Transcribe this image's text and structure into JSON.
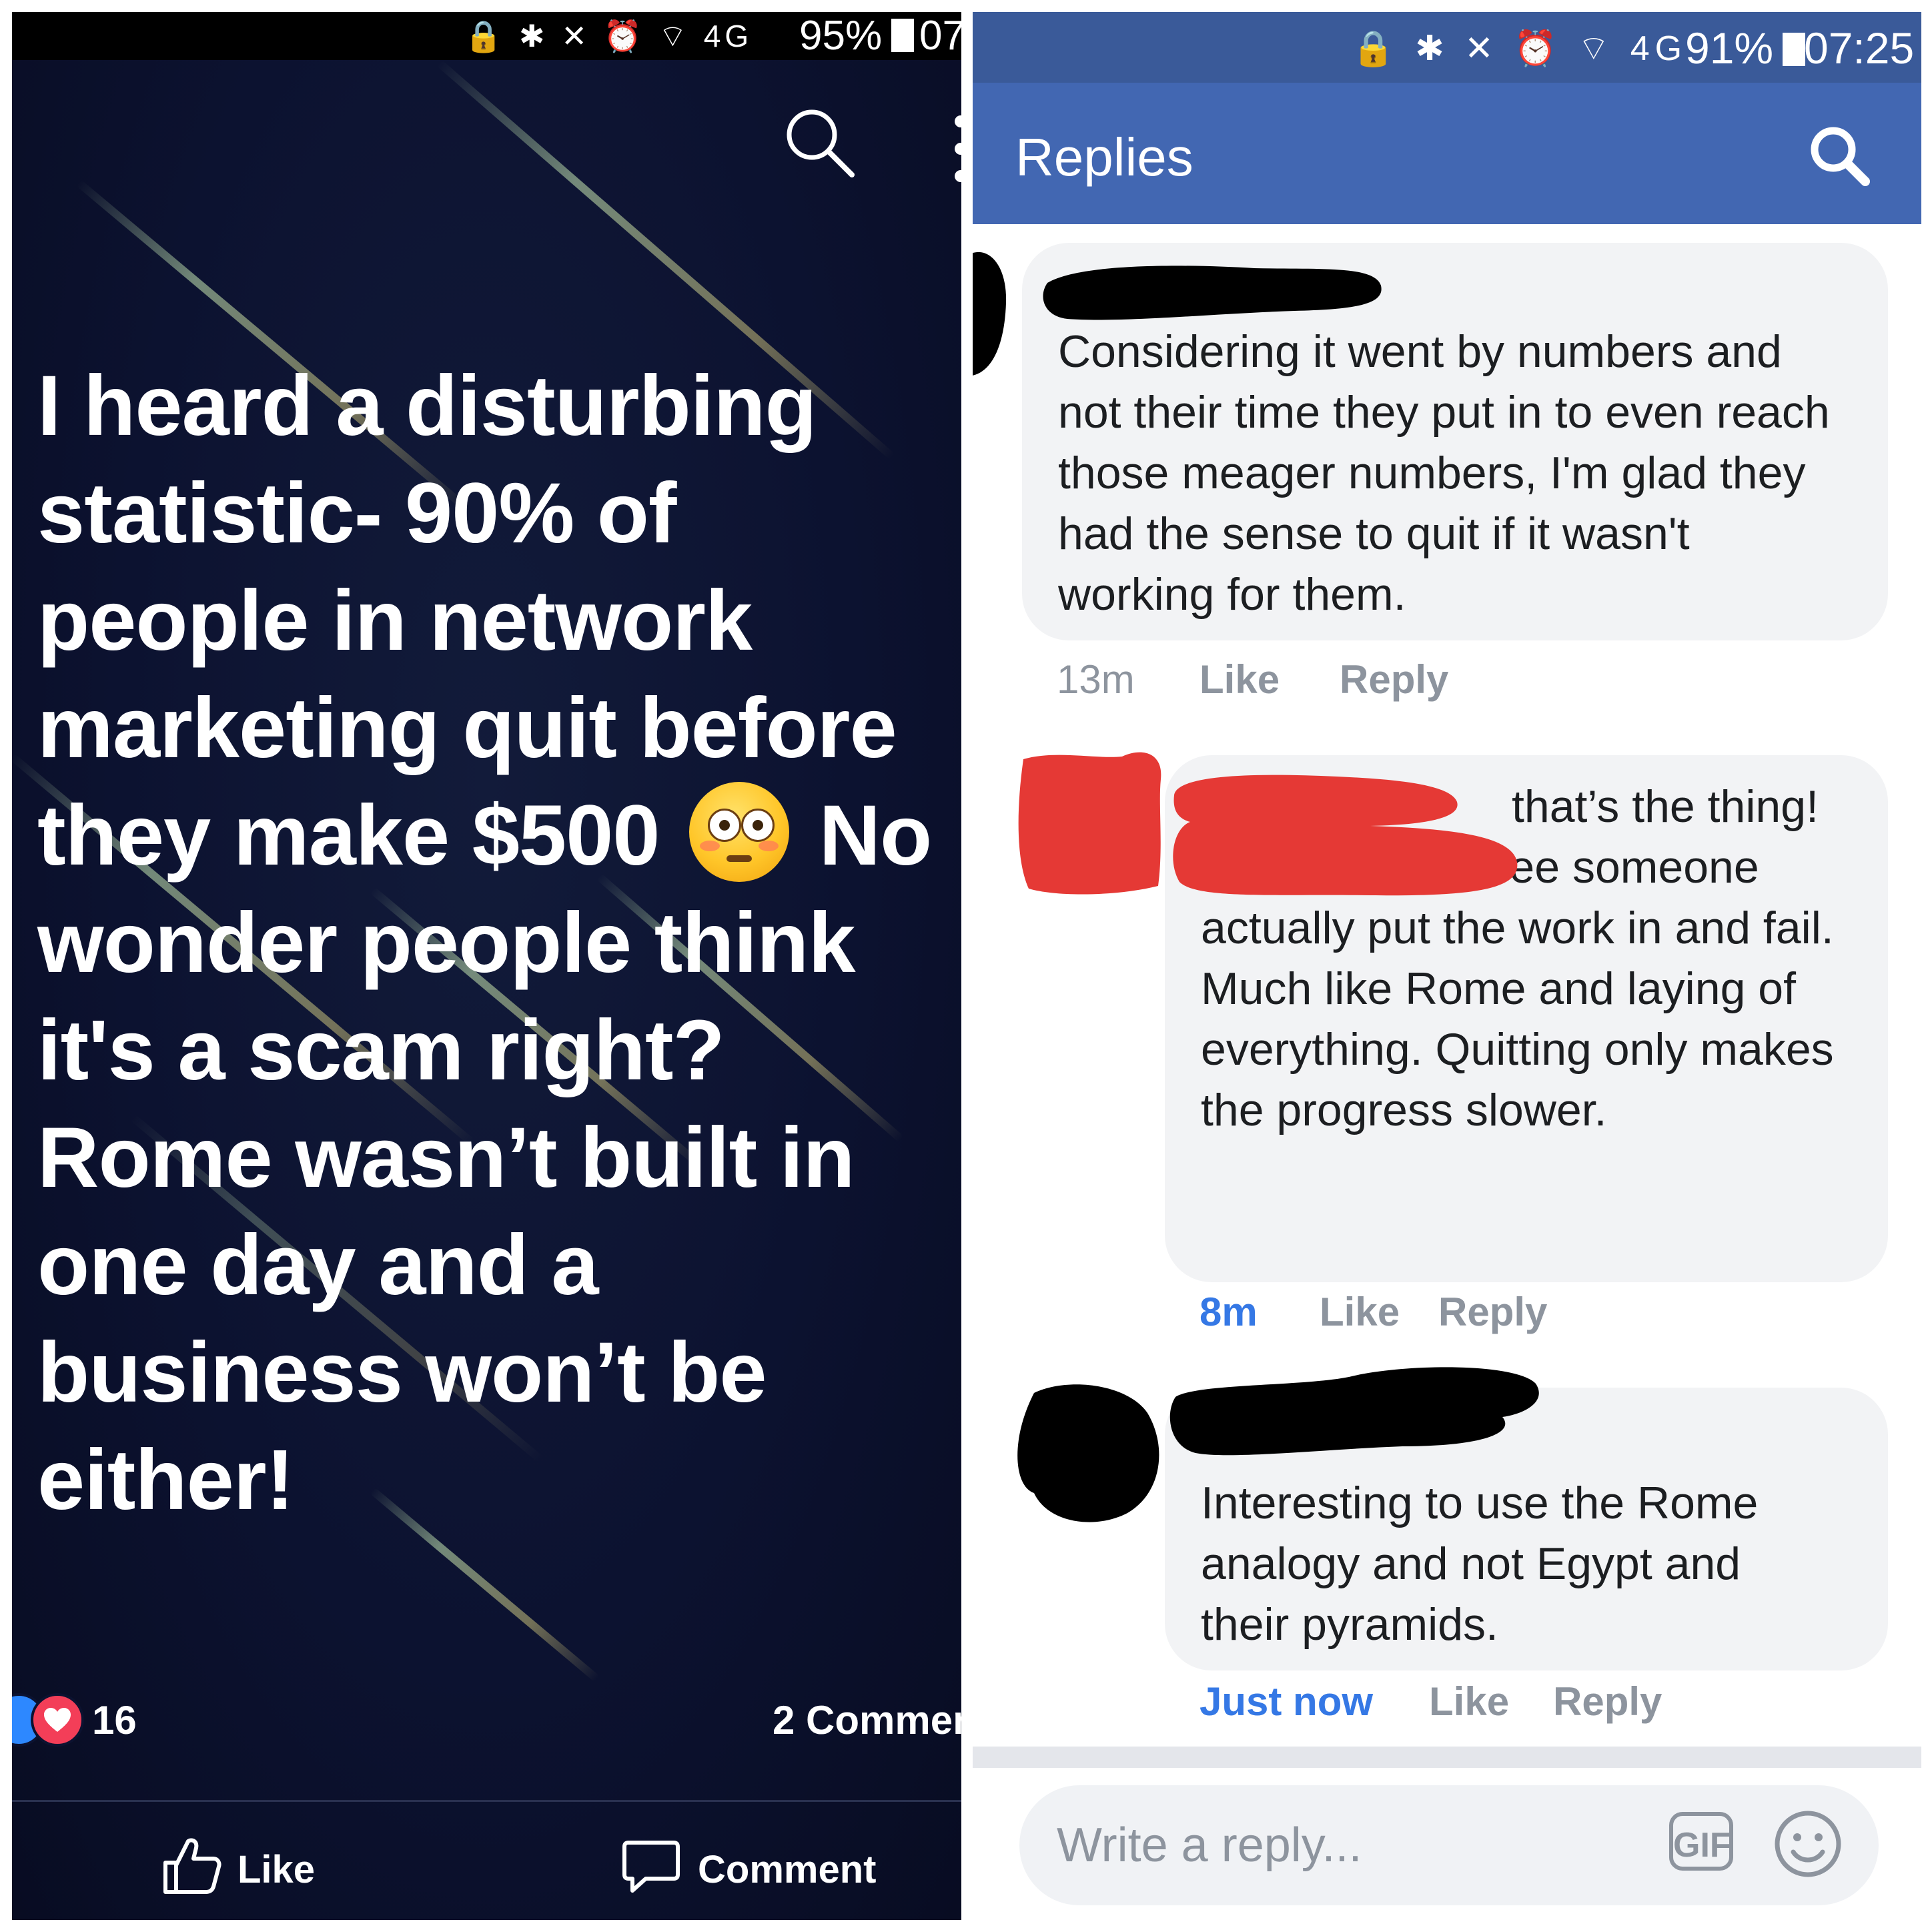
{
  "left_screen": {
    "status_bar": {
      "icons": "🔒 ✱ ✕ ⏰ ⌔ 4G",
      "battery": "95%",
      "time": "07"
    },
    "post": {
      "text_lines": [
        "I heard a disturbing",
        "statistic- 90% of",
        "people in network",
        "marketing quit before",
        "they make $500",
        "No",
        "wonder people think",
        "it's a scam right?",
        "Rome wasn’t built in",
        "one day and a",
        "business won’t be",
        "either!"
      ],
      "emoji": "flushed-face",
      "reaction_count": "16",
      "comments_label": "2 Commen"
    },
    "actions": {
      "like_label": "Like",
      "comment_label": "Comment"
    }
  },
  "right_screen": {
    "status_bar": {
      "icons": "🔒 ✱ ✕ ⏰ ⌔ 4G",
      "battery": "91%",
      "time": "07:25"
    },
    "header_title": "Replies",
    "comments": [
      {
        "author": "",
        "text": "Considering it went by numbers and not their time they put in to even reach those meager numbers, I'm glad they had the sense to quit if it wasn't working for them.",
        "time": "13m",
        "like_label": "Like",
        "reply_label": "Reply"
      },
      {
        "author": "",
        "text_first_line": "that’s the thing!",
        "text": "I have YET to see someone actually put the work in and fail. Much like Rome and laying of everything. Quitting only makes the progress slower.",
        "time": "8m",
        "like_label": "Like",
        "reply_label": "Reply"
      },
      {
        "author": "",
        "text": "Interesting to use the Rome analogy and not Egypt and their pyramids.",
        "time": "Just now",
        "like_label": "Like",
        "reply_label": "Reply"
      }
    ],
    "reply_input": {
      "placeholder": "Write a reply...",
      "gif_label": "GIF"
    },
    "colors": {
      "status_bar": "#3a5a99",
      "app_bar": "#4267b2",
      "bubble": "#f2f3f5",
      "link_blue": "#3578e5",
      "redaction_red": "#e53935",
      "redaction_black": "#000000"
    }
  }
}
